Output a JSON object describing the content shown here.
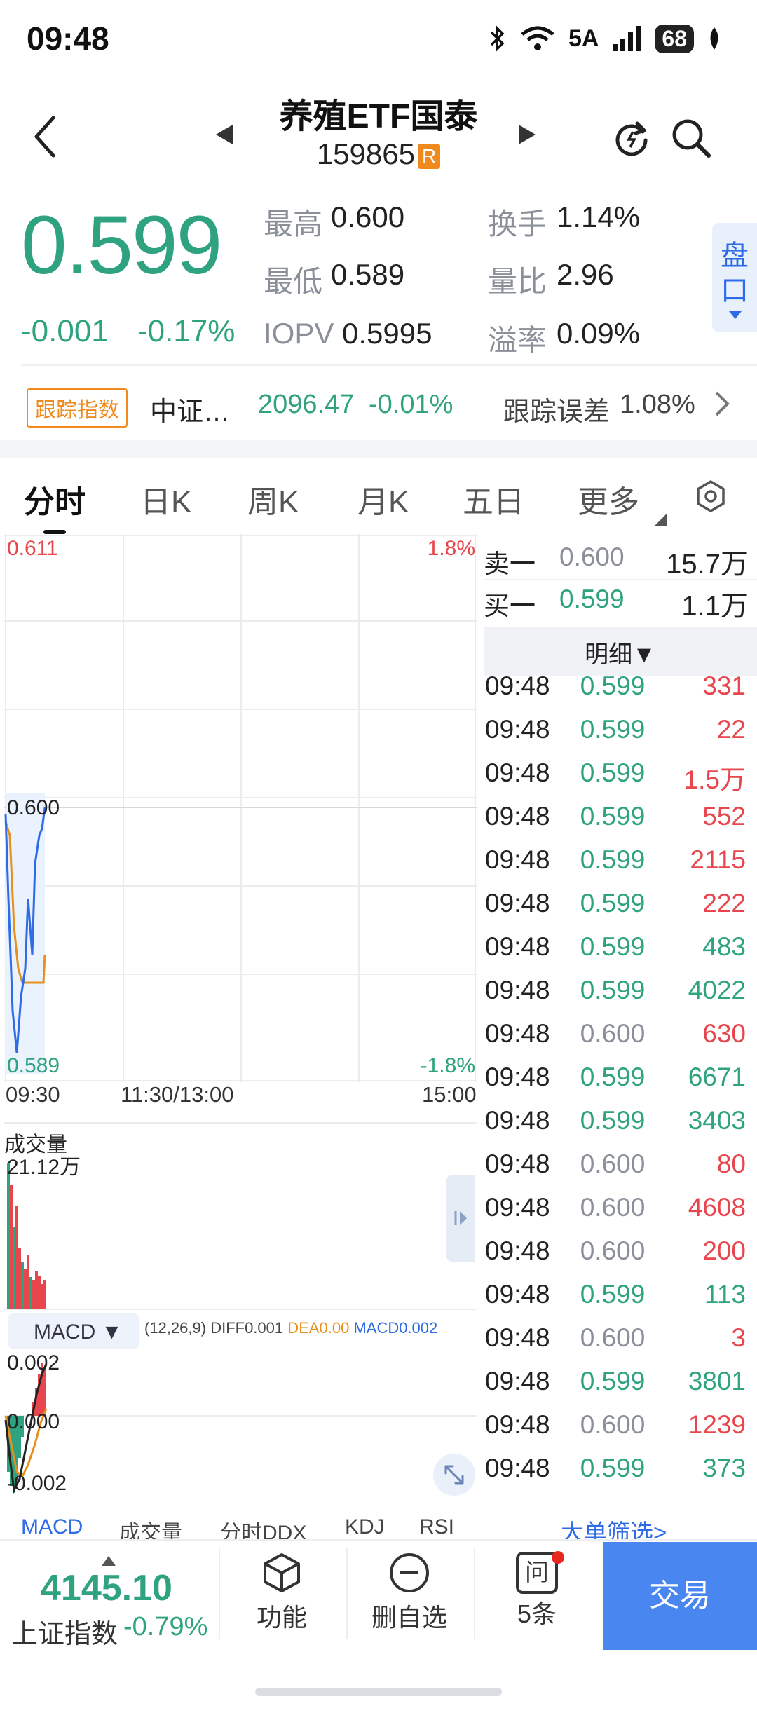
{
  "status_bar": {
    "time": "09:48",
    "network": "5A",
    "battery": "68"
  },
  "header": {
    "name": "养殖ETF国泰",
    "code": "159865",
    "badge": "R"
  },
  "quote": {
    "price": "0.599",
    "change_abs": "-0.001",
    "change_pct": "-0.17%",
    "high_label": "最高",
    "high_value": "0.600",
    "low_label": "最低",
    "low_value": "0.589",
    "iopv_label": "IOPV",
    "iopv_value": "0.5995",
    "turnover_label": "换手",
    "turnover_value": "1.14%",
    "volratio_label": "量比",
    "volratio_value": "2.96",
    "premium_label": "溢率",
    "premium_value": "0.09%",
    "pankou_tab": "盘口"
  },
  "tracking": {
    "badge": "跟踪指数",
    "index_name": "中证…",
    "index_value": "2096.47",
    "index_change": "-0.01%",
    "error_label": "跟踪误差",
    "error_value": "1.08%"
  },
  "tabs": [
    "分时",
    "日K",
    "周K",
    "月K",
    "五日",
    "更多"
  ],
  "chart": {
    "y_top": "0.611",
    "y_mid": "0.600",
    "y_bottom": "0.589",
    "pct_top": "1.8%",
    "pct_bottom": "-1.8%",
    "time_start": "09:30",
    "time_mid": "11:30/13:00",
    "time_end": "15:00"
  },
  "volume": {
    "label": "成交量",
    "value": "21.12万"
  },
  "macd": {
    "selector": "MACD",
    "params": "(12,26,9)",
    "diff": "DIFF0.001",
    "dea": "DEA0.00",
    "macd": "MACD0.002",
    "y_top": "0.002",
    "y_mid": "0.000",
    "y_bottom": "-0.002"
  },
  "indicator_tabs": [
    "MACD",
    "成交量",
    "分时DDX",
    "KDJ",
    "RSI"
  ],
  "order_book": {
    "sell_label": "卖一",
    "sell_price": "0.600",
    "sell_vol": "15.7万",
    "buy_label": "买一",
    "buy_price": "0.599",
    "buy_vol": "1.1万",
    "detail_label": "明细▼",
    "filter_link": "大单筛选>"
  },
  "ticks": [
    {
      "time": "09:48",
      "price": "0.599",
      "vol": "331",
      "dir": "buy"
    },
    {
      "time": "09:48",
      "price": "0.599",
      "vol": "22",
      "dir": "buy"
    },
    {
      "time": "09:48",
      "price": "0.599",
      "vol": "1.5万",
      "dir": "buy"
    },
    {
      "time": "09:48",
      "price": "0.599",
      "vol": "552",
      "dir": "buy"
    },
    {
      "time": "09:48",
      "price": "0.599",
      "vol": "2115",
      "dir": "buy"
    },
    {
      "time": "09:48",
      "price": "0.599",
      "vol": "222",
      "dir": "buy"
    },
    {
      "time": "09:48",
      "price": "0.599",
      "vol": "483",
      "dir": "sell"
    },
    {
      "time": "09:48",
      "price": "0.599",
      "vol": "4022",
      "dir": "sell"
    },
    {
      "time": "09:48",
      "price": "0.600",
      "vol": "630",
      "dir": "buy"
    },
    {
      "time": "09:48",
      "price": "0.599",
      "vol": "6671",
      "dir": "sell"
    },
    {
      "time": "09:48",
      "price": "0.599",
      "vol": "3403",
      "dir": "sell"
    },
    {
      "time": "09:48",
      "price": "0.600",
      "vol": "80",
      "dir": "buy"
    },
    {
      "time": "09:48",
      "price": "0.600",
      "vol": "4608",
      "dir": "buy"
    },
    {
      "time": "09:48",
      "price": "0.600",
      "vol": "200",
      "dir": "buy"
    },
    {
      "time": "09:48",
      "price": "0.599",
      "vol": "113",
      "dir": "sell"
    },
    {
      "time": "09:48",
      "price": "0.600",
      "vol": "3",
      "dir": "buy"
    },
    {
      "time": "09:48",
      "price": "0.599",
      "vol": "3801",
      "dir": "sell"
    },
    {
      "time": "09:48",
      "price": "0.600",
      "vol": "1239",
      "dir": "buy"
    },
    {
      "time": "09:48",
      "price": "0.599",
      "vol": "373",
      "dir": "sell"
    }
  ],
  "bottom_bar": {
    "index_value": "4145.10",
    "index_name": "上证指数",
    "index_change": "-0.79%",
    "function_label": "功能",
    "remove_label": "删自选",
    "ask_label": "5条",
    "ask_icon_char": "问",
    "trade_label": "交易"
  },
  "icons": [
    "back-icon",
    "prev-stock-icon",
    "next-stock-icon",
    "refresh-icon",
    "search-icon",
    "chevron-right-icon",
    "settings-icon",
    "expand-icon",
    "fullscreen-icon",
    "cube-icon",
    "minus-circle-icon",
    "question-icon"
  ],
  "colors": {
    "up": "#e8464c",
    "down": "#2fa37f",
    "accent": "#2e6be6",
    "badge": "#f08a1c"
  }
}
